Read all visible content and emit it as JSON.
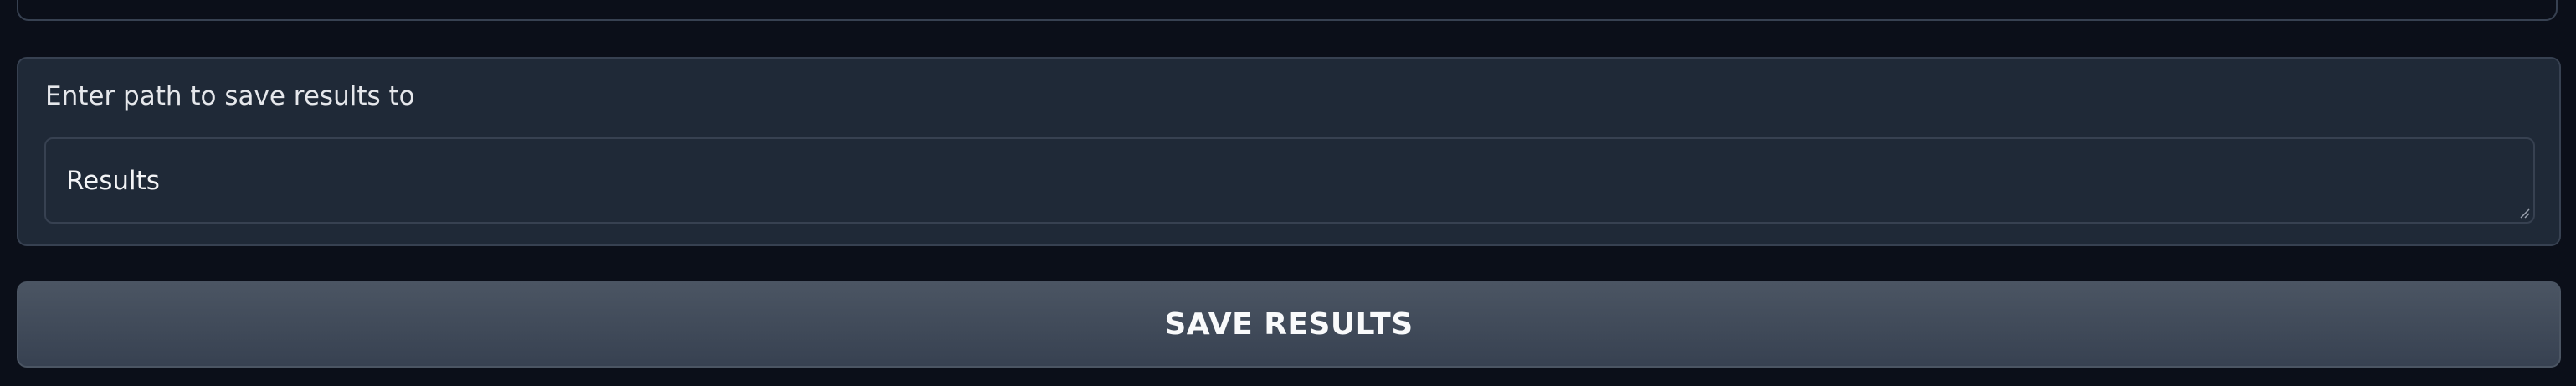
{
  "save_path": {
    "label": "Enter path to save results to",
    "value": "Results"
  },
  "actions": {
    "save_label": "SAVE RESULTS"
  }
}
